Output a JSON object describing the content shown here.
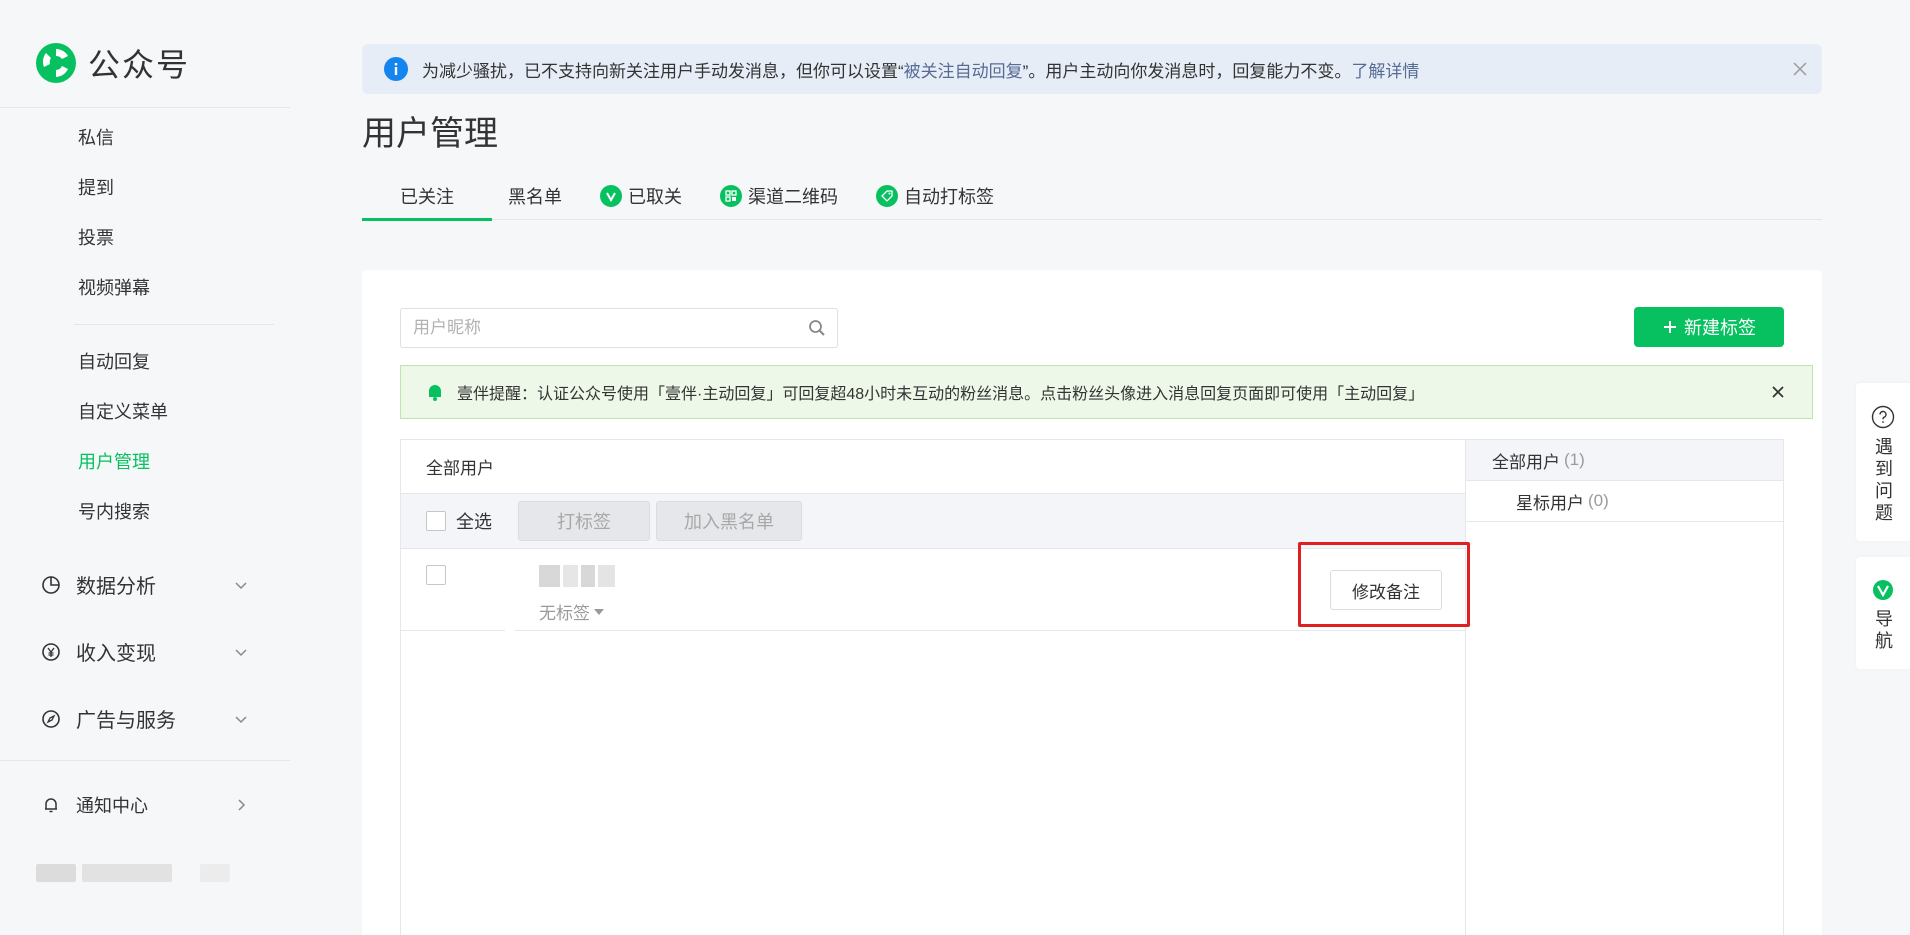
{
  "app": {
    "name": "公众号"
  },
  "sidebar": {
    "items_a": [
      {
        "label": "私信"
      },
      {
        "label": "提到"
      },
      {
        "label": "投票"
      },
      {
        "label": "视频弹幕"
      }
    ],
    "items_b": [
      {
        "label": "自动回复"
      },
      {
        "label": "自定义菜单"
      },
      {
        "label": "用户管理",
        "active": true
      },
      {
        "label": "号内搜索"
      }
    ],
    "groups": [
      {
        "label": "数据分析",
        "icon": "pie-chart-icon"
      },
      {
        "label": "收入变现",
        "icon": "yen-icon"
      },
      {
        "label": "广告与服务",
        "icon": "compass-icon"
      }
    ],
    "notify": {
      "label": "通知中心",
      "icon": "bell-icon"
    }
  },
  "banner": {
    "text_before": "为减少骚扰，已不支持向新关注用户手动发消息，但你可以设置“",
    "link1": "被关注自动回复",
    "text_after": "”。用户主动向你发消息时，回复能力不变。",
    "link2": "了解详情"
  },
  "page": {
    "title": "用户管理"
  },
  "tabs": [
    {
      "label": "已关注",
      "active": true
    },
    {
      "label": "黑名单"
    },
    {
      "label": "已取关",
      "icon": "v-badge-icon"
    },
    {
      "label": "渠道二维码",
      "icon": "qrcode-icon"
    },
    {
      "label": "自动打标签",
      "icon": "tag-icon"
    }
  ],
  "search": {
    "placeholder": "用户昵称"
  },
  "new_tag_button": {
    "label": "新建标签"
  },
  "notice": {
    "text": "壹伴提醒：认证公众号使用「壹伴·主动回复」可回复超48小时未互动的粉丝消息。点击粉丝头像进入消息回复页面即可使用「主动回复」"
  },
  "table": {
    "header": "全部用户",
    "select_all": "全选",
    "tag_button": "打标签",
    "blacklist_button": "加入黑名单",
    "rows": [
      {
        "tag": "无标签",
        "remark_button": "修改备注"
      }
    ]
  },
  "groups": [
    {
      "label": "全部用户",
      "count": "(1)"
    },
    {
      "label": "星标用户",
      "count": "(0)"
    }
  ],
  "float": {
    "help": "遇到问题",
    "nav": "导航"
  },
  "colors": {
    "accent": "#07c160",
    "link": "#576b95",
    "highlight": "#e02020"
  }
}
